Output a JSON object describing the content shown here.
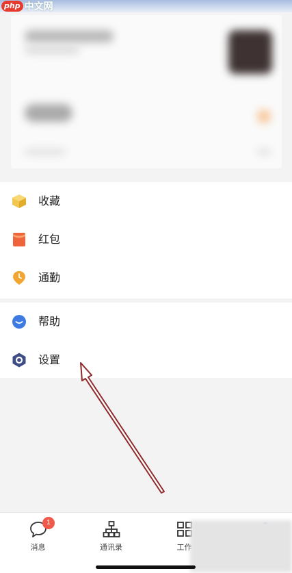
{
  "watermark": {
    "brand": "php",
    "site": "中文网"
  },
  "menu": {
    "favorites": "收藏",
    "red_packet": "红包",
    "commute": "通勤",
    "help": "帮助",
    "settings": "设置"
  },
  "bottom_nav": {
    "messages": "消息",
    "messages_badge": "1",
    "contacts": "通讯录",
    "workbench": "工作"
  },
  "colors": {
    "favorites_icon": "#f3c64e",
    "red_packet_icon": "#f0643c",
    "commute_icon": "#f2a531",
    "help_icon": "#3d7be3",
    "settings_icon": "#3f4d85",
    "annotation_arrow": "#8e2a2a"
  }
}
